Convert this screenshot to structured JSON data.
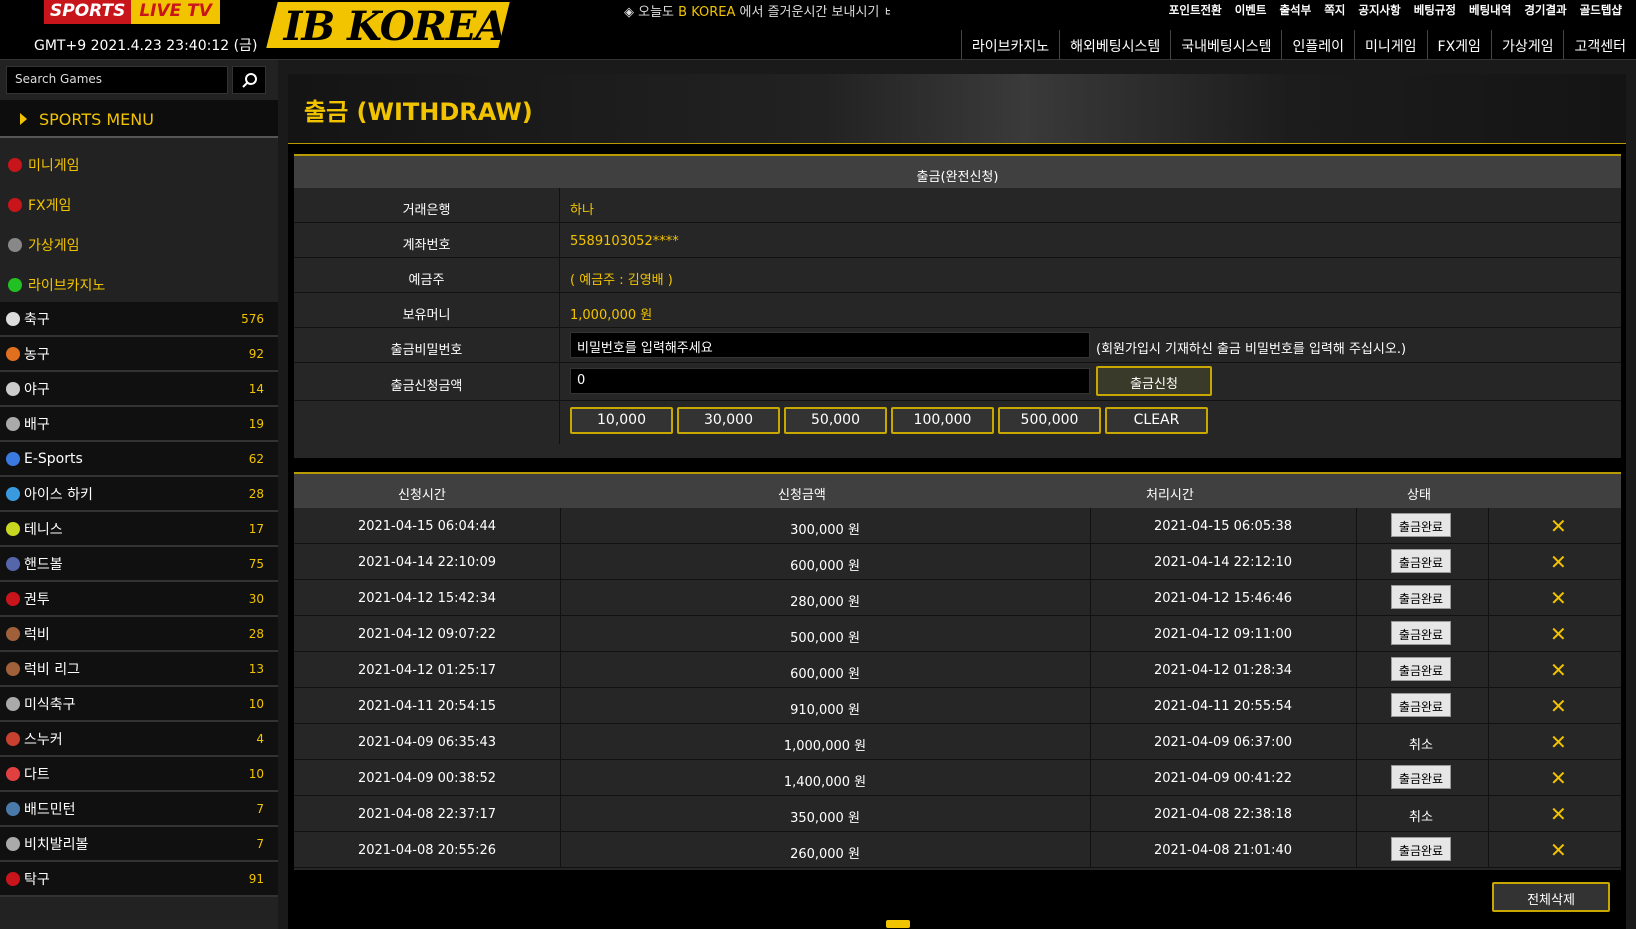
{
  "header": {
    "brand_left": "SPORTS",
    "brand_right": "LIVE TV",
    "clock": "GMT+9 2021.4.23 23:40:12 (금)",
    "logo": "IB KOREA",
    "marquee_prefix": "◈ 오늘도 ",
    "marquee_highlight": "B KOREA",
    "marquee_suffix": " 에서 즐거운시간 보내시기 ㅂ",
    "top_links": [
      "포인트전환",
      "이벤트",
      "출석부",
      "쪽지",
      "공지사항",
      "베팅규정",
      "베팅내역",
      "경기결과",
      "골드텝샵"
    ],
    "main_nav": [
      "라이브카지노",
      "해외베팅시스템",
      "국내베팅시스템",
      "인플레이",
      "미니게임",
      "FX게임",
      "가상게임",
      "고객센터"
    ]
  },
  "sidebar": {
    "search_placeholder": "Search Games",
    "sports_menu_title": "SPORTS MENU",
    "game_links": [
      {
        "label": "미니게임",
        "icon": "minigame-icon",
        "color": "#c8151b"
      },
      {
        "label": "FX게임",
        "icon": "fx-icon",
        "color": "#c8151b"
      },
      {
        "label": "가상게임",
        "icon": "gamepad-icon",
        "color": "#888888"
      },
      {
        "label": "라이브카지노",
        "icon": "casino-chip-icon",
        "color": "#22c022"
      }
    ],
    "sports": [
      {
        "label": "축구",
        "count": "576",
        "icon": "soccer-icon",
        "color": "#dddddd"
      },
      {
        "label": "농구",
        "count": "92",
        "icon": "basketball-icon",
        "color": "#e07020"
      },
      {
        "label": "야구",
        "count": "14",
        "icon": "baseball-icon",
        "color": "#cccccc"
      },
      {
        "label": "배구",
        "count": "19",
        "icon": "volleyball-icon",
        "color": "#aaaaaa"
      },
      {
        "label": "E-Sports",
        "count": "62",
        "icon": "esports-icon",
        "color": "#3a7ae0"
      },
      {
        "label": "아이스 하키",
        "count": "28",
        "icon": "icehockey-icon",
        "color": "#3a9ae0"
      },
      {
        "label": "테니스",
        "count": "17",
        "icon": "tennis-icon",
        "color": "#c8d820"
      },
      {
        "label": "핸드볼",
        "count": "75",
        "icon": "handball-icon",
        "color": "#5566aa"
      },
      {
        "label": "권투",
        "count": "30",
        "icon": "boxing-icon",
        "color": "#c8151b"
      },
      {
        "label": "럭비",
        "count": "28",
        "icon": "rugby-icon",
        "color": "#a0603a"
      },
      {
        "label": "럭비 리그",
        "count": "13",
        "icon": "rugby-league-icon",
        "color": "#a0603a"
      },
      {
        "label": "미식축구",
        "count": "10",
        "icon": "american-football-icon",
        "color": "#aaaaaa"
      },
      {
        "label": "스누커",
        "count": "4",
        "icon": "snooker-icon",
        "color": "#c84030"
      },
      {
        "label": "다트",
        "count": "10",
        "icon": "darts-icon",
        "color": "#e04040"
      },
      {
        "label": "배드민턴",
        "count": "7",
        "icon": "badminton-icon",
        "color": "#4a7aaa"
      },
      {
        "label": "비치발리볼",
        "count": "7",
        "icon": "beach-volleyball-icon",
        "color": "#aaaaaa"
      },
      {
        "label": "탁구",
        "count": "91",
        "icon": "table-tennis-icon",
        "color": "#c8151b"
      }
    ]
  },
  "page": {
    "title": "출금 (WITHDRAW)"
  },
  "withdraw_form": {
    "heading": "출금(완전신청)",
    "bank_label": "거래은행",
    "bank_value": "하나",
    "account_label": "계좌번호",
    "account_value": "5589103052****",
    "holder_label": "예금주",
    "holder_value": "( 예금주 : 김영배 )",
    "balance_label": "보유머니",
    "balance_value": "1,000,000 원",
    "password_label": "출금비밀번호",
    "password_placeholder": "비밀번호를 입력해주세요",
    "password_hint": "(회원가입시 기재하신 출금 비밀번호를 입력해 주십시오.)",
    "amount_label": "출금신청금액",
    "amount_value": "0",
    "apply_button": "출금신청",
    "quick_amounts": [
      "10,000",
      "30,000",
      "50,000",
      "100,000",
      "500,000",
      "CLEAR"
    ]
  },
  "history": {
    "columns": [
      "신청시간",
      "신청금액",
      "처리시간",
      "상태"
    ],
    "rows": [
      {
        "requested": "2021-04-15 06:04:44",
        "amount": "300,000 원",
        "processed": "2021-04-15 06:05:38",
        "status": "출금완료",
        "done": true
      },
      {
        "requested": "2021-04-14 22:10:09",
        "amount": "600,000 원",
        "processed": "2021-04-14 22:12:10",
        "status": "출금완료",
        "done": true
      },
      {
        "requested": "2021-04-12 15:42:34",
        "amount": "280,000 원",
        "processed": "2021-04-12 15:46:46",
        "status": "출금완료",
        "done": true
      },
      {
        "requested": "2021-04-12 09:07:22",
        "amount": "500,000 원",
        "processed": "2021-04-12 09:11:00",
        "status": "출금완료",
        "done": true
      },
      {
        "requested": "2021-04-12 01:25:17",
        "amount": "600,000 원",
        "processed": "2021-04-12 01:28:34",
        "status": "출금완료",
        "done": true
      },
      {
        "requested": "2021-04-11 20:54:15",
        "amount": "910,000 원",
        "processed": "2021-04-11 20:55:54",
        "status": "출금완료",
        "done": true
      },
      {
        "requested": "2021-04-09 06:35:43",
        "amount": "1,000,000 원",
        "processed": "2021-04-09 06:37:00",
        "status": "취소",
        "done": false
      },
      {
        "requested": "2021-04-09 00:38:52",
        "amount": "1,400,000 원",
        "processed": "2021-04-09 00:41:22",
        "status": "출금완료",
        "done": true
      },
      {
        "requested": "2021-04-08 22:37:17",
        "amount": "350,000 원",
        "processed": "2021-04-08 22:38:18",
        "status": "취소",
        "done": false
      },
      {
        "requested": "2021-04-08 20:55:26",
        "amount": "260,000 원",
        "processed": "2021-04-08 21:01:40",
        "status": "출금완료",
        "done": true
      }
    ],
    "delete_icon": "close-x-icon",
    "delete_all_button": "전체삭제"
  },
  "colors": {
    "accent": "#f2c400",
    "brand_red": "#c8151b"
  }
}
